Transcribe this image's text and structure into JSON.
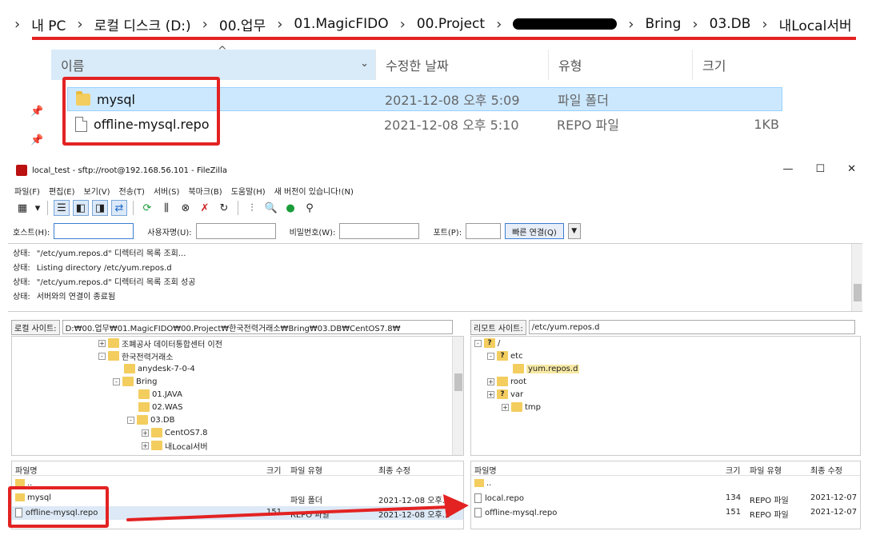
{
  "explorer": {
    "breadcrumb": [
      "내 PC",
      "로컬 디스크 (D:)",
      "00.업무",
      "01.MagicFIDO",
      "00.Project",
      "Bring",
      "03.DB",
      "내Local서버"
    ],
    "columns": {
      "name": "이름",
      "date": "수정한 날짜",
      "type": "유형",
      "size": "크기"
    },
    "files": [
      {
        "name": "mysql",
        "date": "2021-12-08 오후 5:09",
        "type": "파일 폴더",
        "size": "",
        "icon": "folder-icon"
      },
      {
        "name": "offline-mysql.repo",
        "date": "2021-12-08 오후 5:10",
        "type": "REPO 파일",
        "size": "1KB",
        "icon": "document-icon"
      }
    ]
  },
  "filezilla": {
    "title": "local_test - sftp://root@192.168.56.101 - FileZilla",
    "menu": [
      "파일(F)",
      "편집(E)",
      "보기(V)",
      "전송(T)",
      "서버(S)",
      "북마크(B)",
      "도움말(H)",
      "새 버전이 있습니다!(N)"
    ],
    "quickconnect": {
      "host_label": "호스트(H):",
      "user_label": "사용자명(U):",
      "pass_label": "비밀번호(W):",
      "port_label": "포트(P):",
      "button": "빠른 연결(Q)"
    },
    "log": [
      {
        "label": "상태:",
        "text": "\"/etc/yum.repos.d\" 디렉터리 목록 조회..."
      },
      {
        "label": "상태:",
        "text": "Listing directory /etc/yum.repos.d"
      },
      {
        "label": "상태:",
        "text": "\"/etc/yum.repos.d\" 디렉터리 목록 조회 성공"
      },
      {
        "label": "상태:",
        "text": "서버와의 연결이 종료됨"
      }
    ],
    "local": {
      "site_label": "로컬 사이트:",
      "path": "D:₩00.업무₩01.MagicFIDO₩00.Project₩한국전력거래소₩Bring₩03.DB₩CentOS7.8₩",
      "tree": [
        {
          "label": "조폐공사 데이터통합센터 이전",
          "exp": "+"
        },
        {
          "label": "한국전력거래소",
          "exp": "-"
        },
        {
          "label": "anydesk-7-0-4",
          "exp": ""
        },
        {
          "label": "Bring",
          "exp": "-"
        },
        {
          "label": "01.JAVA",
          "exp": ""
        },
        {
          "label": "02.WAS",
          "exp": ""
        },
        {
          "label": "03.DB",
          "exp": "-"
        },
        {
          "label": "CentOS7.8",
          "exp": "+"
        },
        {
          "label": "내Local서버",
          "exp": "+"
        }
      ],
      "list_headers": {
        "name": "파일명",
        "size": "크기",
        "type": "파일 유형",
        "modified": "최종 수정"
      },
      "rows": [
        {
          "name": "..",
          "size": "",
          "type": "",
          "modified": "",
          "icon": "folder-icon"
        },
        {
          "name": "mysql",
          "size": "",
          "type": "파일 폴더",
          "modified": "2021-12-08 오후...",
          "icon": "folder-icon"
        },
        {
          "name": "offline-mysql.repo",
          "size": "151",
          "type": "REPO 파일",
          "modified": "2021-12-08 오후...",
          "icon": "document-icon"
        }
      ]
    },
    "remote": {
      "site_label": "리모트 사이트:",
      "path": "/etc/yum.repos.d",
      "tree": [
        {
          "label": "/",
          "exp": "-",
          "q": true
        },
        {
          "label": "etc",
          "exp": "-",
          "q": true
        },
        {
          "label": "yum.repos.d",
          "exp": "",
          "q": false
        },
        {
          "label": "root",
          "exp": "+",
          "q": false
        },
        {
          "label": "var",
          "exp": "+",
          "q": true
        },
        {
          "label": "tmp",
          "exp": "+",
          "q": false
        }
      ],
      "list_headers": {
        "name": "파일명",
        "size": "크기",
        "type": "파일 유형",
        "modified": "최종 수정"
      },
      "rows": [
        {
          "name": "..",
          "size": "",
          "type": "",
          "modified": "",
          "icon": "folder-icon"
        },
        {
          "name": "local.repo",
          "size": "134",
          "type": "REPO 파일",
          "modified": "2021-12-07 ...",
          "icon": "document-icon"
        },
        {
          "name": "offline-mysql.repo",
          "size": "151",
          "type": "REPO 파일",
          "modified": "2021-12-07 ...",
          "icon": "document-icon"
        }
      ]
    }
  },
  "colors": {
    "annotation_red": "#e32222",
    "selection_blue": "#cce8ff",
    "folder_yellow": "#f3cd5e"
  }
}
